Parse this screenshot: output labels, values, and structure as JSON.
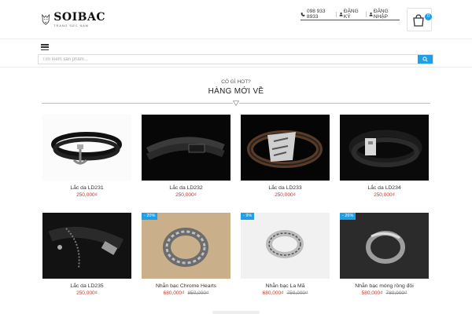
{
  "header": {
    "logo_name": "SOIBAC",
    "logo_sub": "TRANG SỨC NAM",
    "phone": "098 933 8933",
    "register": "ĐĂNG KÝ",
    "login": "ĐĂNG NHẬP",
    "cart_count": "0"
  },
  "search": {
    "placeholder": "Tìm kiếm sản phẩm..."
  },
  "section": {
    "subtitle": "CÓ GÌ HOT?",
    "title": "HÀNG MỚI VỀ"
  },
  "products": [
    {
      "name": "Lắc da LD231",
      "price": "250,000₫",
      "old_price": "",
      "badge": ""
    },
    {
      "name": "Lắc da LD232",
      "price": "250,000₫",
      "old_price": "",
      "badge": ""
    },
    {
      "name": "Lắc da LD233",
      "price": "250,000₫",
      "old_price": "",
      "badge": ""
    },
    {
      "name": "Lắc da LD234",
      "price": "250,000₫",
      "old_price": "",
      "badge": ""
    },
    {
      "name": "Lắc da LD235",
      "price": "250,000₫",
      "old_price": "",
      "badge": ""
    },
    {
      "name": "Nhẫn bạc Chrome Hearts",
      "price": "680,000₫",
      "old_price": "850,000₫",
      "badge": "- 20%"
    },
    {
      "name": "Nhẫn bạc La Mã",
      "price": "680,000₫",
      "old_price": "750,000₫",
      "badge": "- 9%"
    },
    {
      "name": "Nhẫn bạc móng rồng đôi",
      "price": "580,000₫",
      "old_price": "780,000₫",
      "badge": "- 26%"
    }
  ],
  "colors": {
    "accent": "#1e9fe6",
    "price": "#c0392b"
  },
  "icons": [
    "wolf-logo-icon",
    "phone-icon",
    "user-icon",
    "cart-icon",
    "hamburger-icon",
    "search-icon",
    "chevron-down-icon"
  ]
}
